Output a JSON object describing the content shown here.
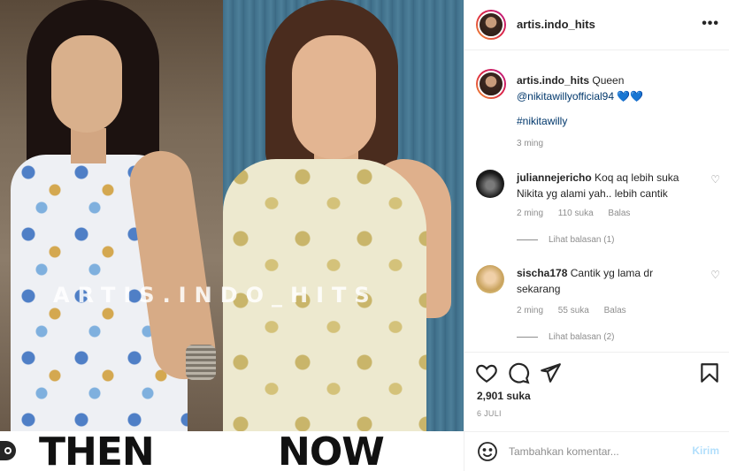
{
  "post": {
    "username": "artis.indo_hits",
    "watermark": "ARTIS.INDO_HITS",
    "labels": {
      "then": "THEN",
      "now": "NOW"
    }
  },
  "header": {
    "username": "artis.indo_hits",
    "more": "•••"
  },
  "caption": {
    "username": "artis.indo_hits",
    "text": "Queen",
    "mention": "@nikitawillyofficial94",
    "emoji": "💙💙",
    "hashtag": "#nikitawilly",
    "time": "3 ming"
  },
  "comments": [
    {
      "username": "juliannejericho",
      "text": "Koq aq lebih suka Nikita yg alami yah.. lebih cantik",
      "time": "2 ming",
      "likes": "110 suka",
      "reply": "Balas",
      "view_replies": "Lihat balasan (1)"
    },
    {
      "username": "sischa178",
      "text": "Cantik yg lama dr sekarang",
      "time": "2 ming",
      "likes": "55 suka",
      "reply": "Balas",
      "view_replies": "Lihat balasan (2)"
    }
  ],
  "actions": {
    "likes": "2,901 suka",
    "date": "6 JULI"
  },
  "add_comment": {
    "placeholder": "Tambahkan komentar...",
    "post_label": "Kirim"
  },
  "icons": [
    "heart-icon",
    "comment-icon",
    "share-icon",
    "bookmark-icon",
    "emoji-icon",
    "more-icon",
    "user-tag-icon"
  ]
}
